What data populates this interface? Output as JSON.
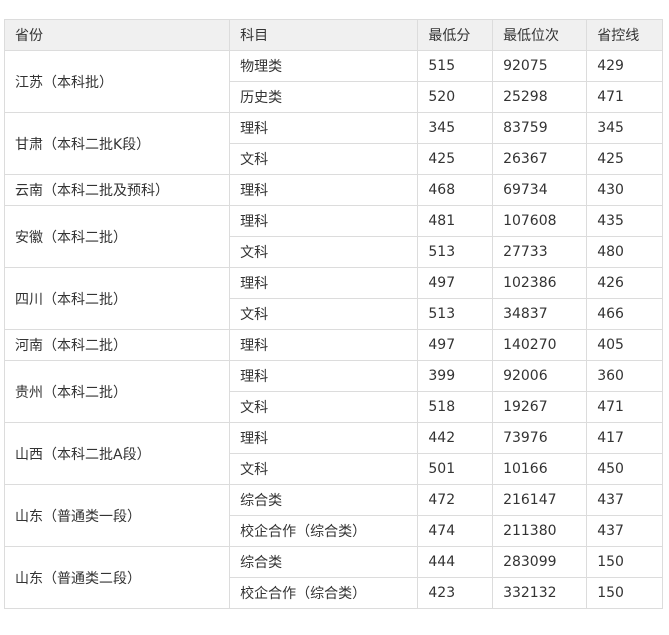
{
  "headers": [
    "省份",
    "科目",
    "最低分",
    "最低位次",
    "省控线"
  ],
  "groups": [
    {
      "province": "江苏（本科批）",
      "rows": [
        {
          "subject": "物理类",
          "min_score": "515",
          "min_rank": "92075",
          "control_line": "429"
        },
        {
          "subject": "历史类",
          "min_score": "520",
          "min_rank": "25298",
          "control_line": "471"
        }
      ]
    },
    {
      "province": "甘肃（本科二批K段）",
      "rows": [
        {
          "subject": "理科",
          "min_score": "345",
          "min_rank": "83759",
          "control_line": "345"
        },
        {
          "subject": "文科",
          "min_score": "425",
          "min_rank": "26367",
          "control_line": "425"
        }
      ]
    },
    {
      "province": "云南（本科二批及预科）",
      "rows": [
        {
          "subject": "理科",
          "min_score": "468",
          "min_rank": "69734",
          "control_line": "430"
        }
      ]
    },
    {
      "province": "安徽（本科二批）",
      "rows": [
        {
          "subject": "理科",
          "min_score": "481",
          "min_rank": "107608",
          "control_line": "435"
        },
        {
          "subject": "文科",
          "min_score": "513",
          "min_rank": "27733",
          "control_line": "480"
        }
      ]
    },
    {
      "province": "四川（本科二批）",
      "rows": [
        {
          "subject": "理科",
          "min_score": "497",
          "min_rank": "102386",
          "control_line": "426"
        },
        {
          "subject": "文科",
          "min_score": "513",
          "min_rank": "34837",
          "control_line": "466"
        }
      ]
    },
    {
      "province": "河南（本科二批）",
      "rows": [
        {
          "subject": "理科",
          "min_score": "497",
          "min_rank": "140270",
          "control_line": "405"
        }
      ]
    },
    {
      "province": "贵州（本科二批）",
      "rows": [
        {
          "subject": "理科",
          "min_score": "399",
          "min_rank": "92006",
          "control_line": "360"
        },
        {
          "subject": "文科",
          "min_score": "518",
          "min_rank": "19267",
          "control_line": "471"
        }
      ]
    },
    {
      "province": "山西（本科二批A段）",
      "rows": [
        {
          "subject": "理科",
          "min_score": "442",
          "min_rank": "73976",
          "control_line": "417"
        },
        {
          "subject": "文科",
          "min_score": "501",
          "min_rank": "10166",
          "control_line": "450"
        }
      ]
    },
    {
      "province": "山东（普通类一段）",
      "rows": [
        {
          "subject": "综合类",
          "min_score": "472",
          "min_rank": "216147",
          "control_line": "437"
        },
        {
          "subject": "校企合作（综合类）",
          "min_score": "474",
          "min_rank": "211380",
          "control_line": "437"
        }
      ]
    },
    {
      "province": "山东（普通类二段）",
      "rows": [
        {
          "subject": "综合类",
          "min_score": "444",
          "min_rank": "283099",
          "control_line": "150"
        },
        {
          "subject": "校企合作（综合类）",
          "min_score": "423",
          "min_rank": "332132",
          "control_line": "150"
        }
      ]
    }
  ]
}
